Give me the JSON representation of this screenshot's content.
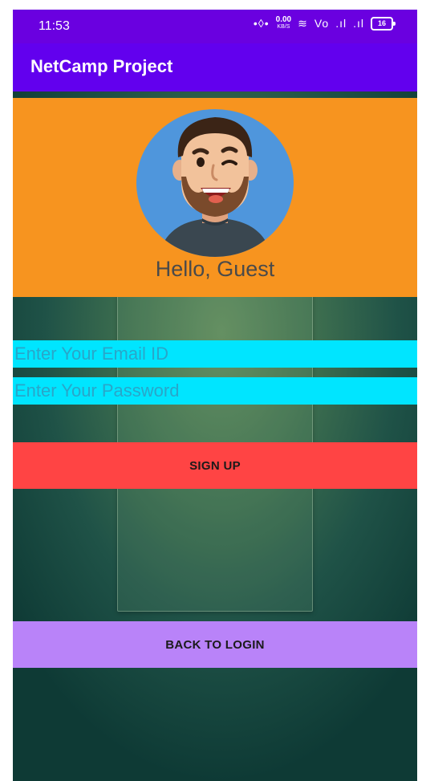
{
  "status_bar": {
    "time": "11:53",
    "vibrate_symbol": "•◊•",
    "net_speed_value": "0.00",
    "net_speed_unit": "KB/S",
    "wifi_symbol": "≋",
    "lte_symbol": "Vo",
    "signal1_symbol": ".ıl",
    "signal2_symbol": ".ıl",
    "battery_level": "16"
  },
  "app_bar": {
    "title": "NetCamp Project"
  },
  "header": {
    "greeting": "Hello, Guest",
    "avatar_icon": "avatar-man-winking-icon"
  },
  "form": {
    "email_placeholder": "Enter Your Email ID",
    "email_value": "",
    "password_placeholder": "Enter Your Password",
    "password_value": ""
  },
  "buttons": {
    "signup_label": "SIGN UP",
    "back_to_login_label": "BACK TO LOGIN"
  },
  "colors": {
    "status_bar": "#6a00e0",
    "app_bar": "#6200ee",
    "header_card": "#f7941f",
    "input_fields": "#00e5ff",
    "signup_button": "#ff4444",
    "back_to_login_button": "#b983f9"
  }
}
